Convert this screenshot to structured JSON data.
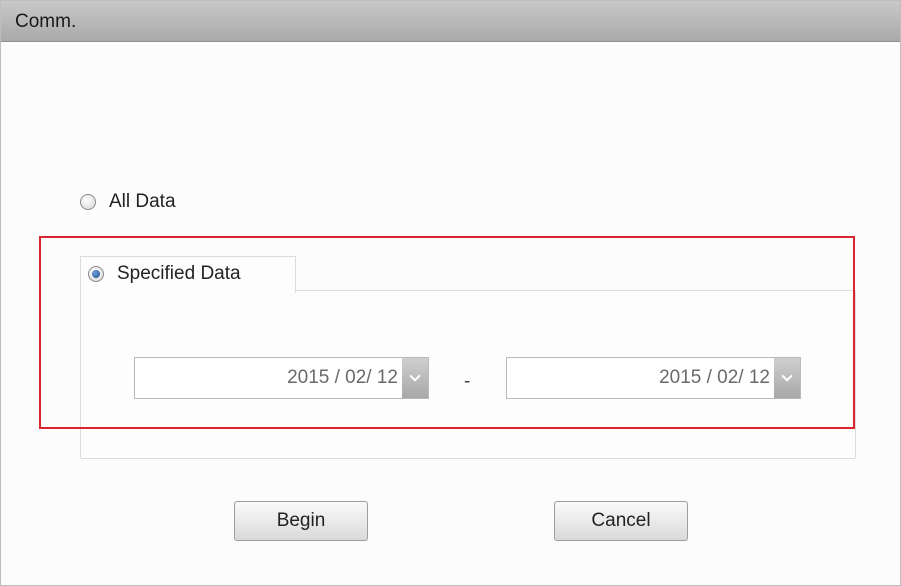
{
  "window": {
    "title": "Comm."
  },
  "options": {
    "all_data": {
      "label": "All Data",
      "checked": false
    },
    "specified_data": {
      "label": "Specified Data",
      "checked": true
    }
  },
  "date_range": {
    "start": "2015 / 02/ 12",
    "separator": "-",
    "end": "2015 / 02/ 12"
  },
  "buttons": {
    "begin": "Begin",
    "cancel": "Cancel"
  },
  "colors": {
    "highlight": "#d8262e",
    "radio_selected": "#1d4f8f"
  }
}
